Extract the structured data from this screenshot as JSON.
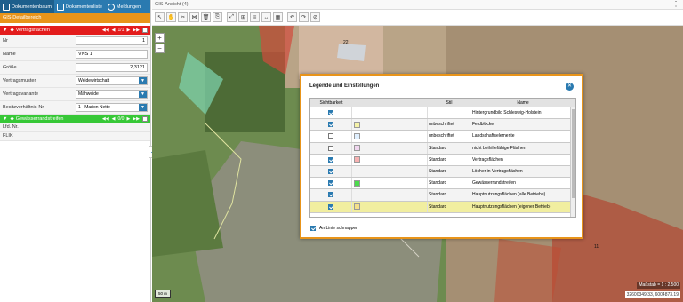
{
  "tabs": [
    {
      "label": "Dokumentenbaum",
      "icon": "tree-icon"
    },
    {
      "label": "Dokumentenliste",
      "icon": "list-icon"
    },
    {
      "label": "Meldungen",
      "icon": "info-icon"
    }
  ],
  "left": {
    "section_title": "GIS-Detailbereich",
    "red_bar": {
      "label": "Vertragsflächen",
      "pager": "1/1"
    },
    "fields": {
      "nr": {
        "label": "Nr",
        "value": "1"
      },
      "name": {
        "label": "Name",
        "value": "VNS 1"
      },
      "groesse": {
        "label": "Größe",
        "value": "2,3121"
      },
      "vertragsmuster": {
        "label": "Vertragsmuster",
        "value": "Weidewirtschaft"
      },
      "vertragsvariante": {
        "label": "Vertragsvariante",
        "value": "Mähweide"
      },
      "besitz": {
        "label": "Besitzverhältnis-Nr.",
        "value": "1 - Marion Nette"
      }
    },
    "green_bar": {
      "label": "Gewässerrandstreifen",
      "pager": "0/0"
    },
    "lfd_nr": "Lfd. Nr.",
    "flik": "FLIK"
  },
  "map": {
    "title": "GIS-Ansicht (4)",
    "scale_bar": "50 m",
    "massstab": "Maßstab = 1 : 2.500",
    "coords": "32600349.33, 6004873.19",
    "parcel_labels": [
      "22",
      "11"
    ]
  },
  "dialog": {
    "title": "Legende und Einstellungen",
    "columns": [
      "Sichtbarkeit",
      "Stil",
      "Name"
    ],
    "rows": [
      {
        "checked": true,
        "swatch": "",
        "stil": "",
        "name": "Hintergrundbild Schleswig-Holstein"
      },
      {
        "checked": true,
        "swatch": "#f6f3a8",
        "stil": "unbeschriftet",
        "name": "Feldblöcke"
      },
      {
        "checked": false,
        "swatch": "#e0f0ff",
        "stil": "unbeschriftet",
        "name": "Landschaftselemente"
      },
      {
        "checked": false,
        "swatch": "#f0d6ef",
        "stil": "Standard",
        "name": "nicht beihilfefähige Flächen"
      },
      {
        "checked": true,
        "swatch": "#f7b1b1",
        "stil": "Standard",
        "name": "Vertragsflächen"
      },
      {
        "checked": true,
        "swatch": "",
        "stil": "Standard",
        "name": "Löcher in Vertragsflächen"
      },
      {
        "checked": true,
        "swatch": "#4ddb4d",
        "stil": "Standard",
        "name": "Gewässerrandstreifen"
      },
      {
        "checked": true,
        "swatch": "",
        "stil": "Standard",
        "name": "Hauptnutzungsflächen (alle Betriebe)"
      },
      {
        "checked": true,
        "swatch": "#f5e08a",
        "stil": "Standard",
        "name": "Hauptnutzungsflächen (eigener Betrieb)"
      }
    ],
    "snap_label": "An Linie schnappen",
    "snap_checked": true
  },
  "colors": {
    "accent": "#e8941a",
    "primary": "#2a7ab0",
    "red": "#e31c1c",
    "green": "#37c837"
  }
}
